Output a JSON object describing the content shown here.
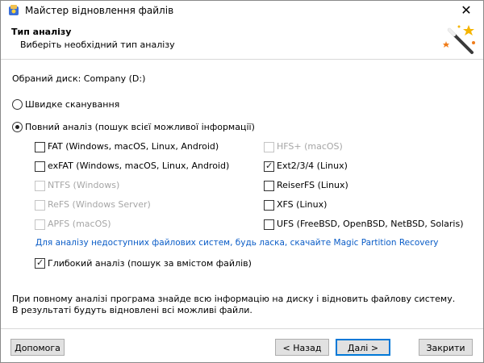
{
  "window": {
    "title": "Майстер відновлення файлів",
    "close_icon": "close-icon"
  },
  "header": {
    "title": "Тип аналізу",
    "subtitle": "Виберіть необхідний тип аналізу"
  },
  "disk_label": "Обраний диск: Company (D:)",
  "analysis": {
    "quick": {
      "label": "Швидке сканування",
      "selected": false
    },
    "full": {
      "label": "Повний аналіз (пошук всієї можливої інформації)",
      "selected": true
    }
  },
  "filesystems_left": [
    {
      "label": "FAT (Windows, macOS, Linux, Android)",
      "checked": false,
      "enabled": true
    },
    {
      "label": "exFAT (Windows, macOS, Linux, Android)",
      "checked": false,
      "enabled": true
    },
    {
      "label": "NTFS (Windows)",
      "checked": false,
      "enabled": false
    },
    {
      "label": "ReFS (Windows Server)",
      "checked": false,
      "enabled": false
    },
    {
      "label": "APFS (macOS)",
      "checked": false,
      "enabled": false
    }
  ],
  "filesystems_right": [
    {
      "label": "HFS+ (macOS)",
      "checked": false,
      "enabled": false
    },
    {
      "label": "Ext2/3/4 (Linux)",
      "checked": true,
      "enabled": true
    },
    {
      "label": "ReiserFS (Linux)",
      "checked": false,
      "enabled": true
    },
    {
      "label": "XFS (Linux)",
      "checked": false,
      "enabled": true
    },
    {
      "label": "UFS (FreeBSD, OpenBSD, NetBSD, Solaris)",
      "checked": false,
      "enabled": true
    }
  ],
  "link_text": "Для аналізу недоступних файлових систем, будь ласка, скачайте Magic Partition Recovery",
  "deep_scan": {
    "label": "Глибокий аналіз (пошук за вмістом файлів)",
    "checked": true
  },
  "info_text": "При повному аналізі програма знайде всю інформацію на диску і відновить файлову систему. В результаті будуть відновлені всі можливі файли.",
  "buttons": {
    "help": "Допомога",
    "back": "< Назад",
    "next": "Далі >",
    "cancel": "Закрити"
  },
  "colors": {
    "link": "#0a5cc7",
    "accent": "#0078d7",
    "disabled": "#a6a6a6"
  }
}
